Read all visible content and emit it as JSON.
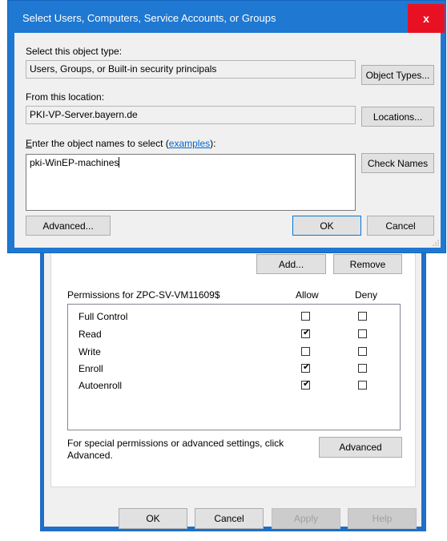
{
  "properties_dialog": {
    "add_label": "Add...",
    "remove_label": "Remove",
    "permissions_for": "Permissions for ZPC-SV-VM11609$",
    "allow_header": "Allow",
    "deny_header": "Deny",
    "permissions": [
      {
        "name": "Full Control",
        "allow": false,
        "deny": false
      },
      {
        "name": "Read",
        "allow": true,
        "deny": false
      },
      {
        "name": "Write",
        "allow": false,
        "deny": false
      },
      {
        "name": "Enroll",
        "allow": true,
        "deny": false
      },
      {
        "name": "Autoenroll",
        "allow": true,
        "deny": false
      }
    ],
    "special_text_line1": "For special permissions or advanced settings, click",
    "special_text_line2": "Advanced.",
    "advanced_label": "Advanced",
    "ok_label": "OK",
    "cancel_label": "Cancel",
    "apply_label": "Apply",
    "help_label": "Help"
  },
  "select_dialog": {
    "title": "Select Users, Computers, Service Accounts, or Groups",
    "close_glyph": "x",
    "object_type_label": "Select this object type:",
    "object_type_value": "Users, Groups, or Built-in security principals",
    "object_types_button": "Object Types...",
    "location_label": "From this location:",
    "location_value": "PKI-VP-Server.bayern.de",
    "locations_button": "Locations...",
    "enter_names_prefix": "E",
    "enter_names_label": "nter the object names to select (",
    "examples_link": "examples",
    "enter_names_suffix": "):",
    "names_value": "pki-WinEP-machines",
    "check_names_button": "Check Names",
    "advanced_button": "Advanced...",
    "ok_button": "OK",
    "cancel_button": "Cancel"
  },
  "colors": {
    "title_bar": "#1f78d1",
    "close_button": "#e81123",
    "link": "#0066cc"
  }
}
